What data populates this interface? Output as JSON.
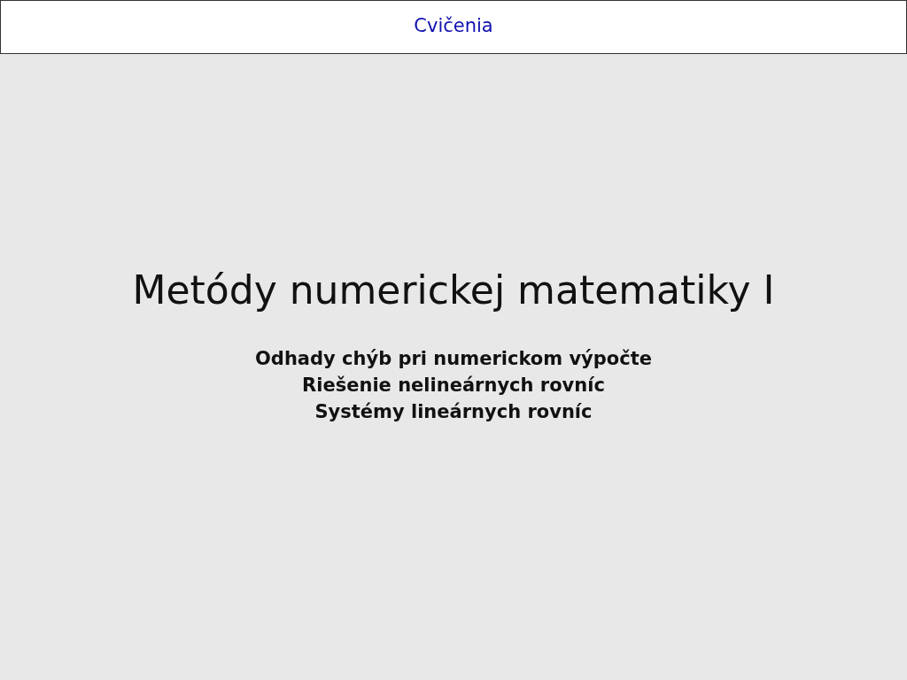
{
  "header": {
    "link": "Cvičenia"
  },
  "slide": {
    "title": "Metódy numerickej matematiky I",
    "subtitles": [
      "Odhady chýb pri numerickom výpočte",
      "Riešenie nelineárnych rovníc",
      "Systémy lineárnych rovníc"
    ]
  }
}
